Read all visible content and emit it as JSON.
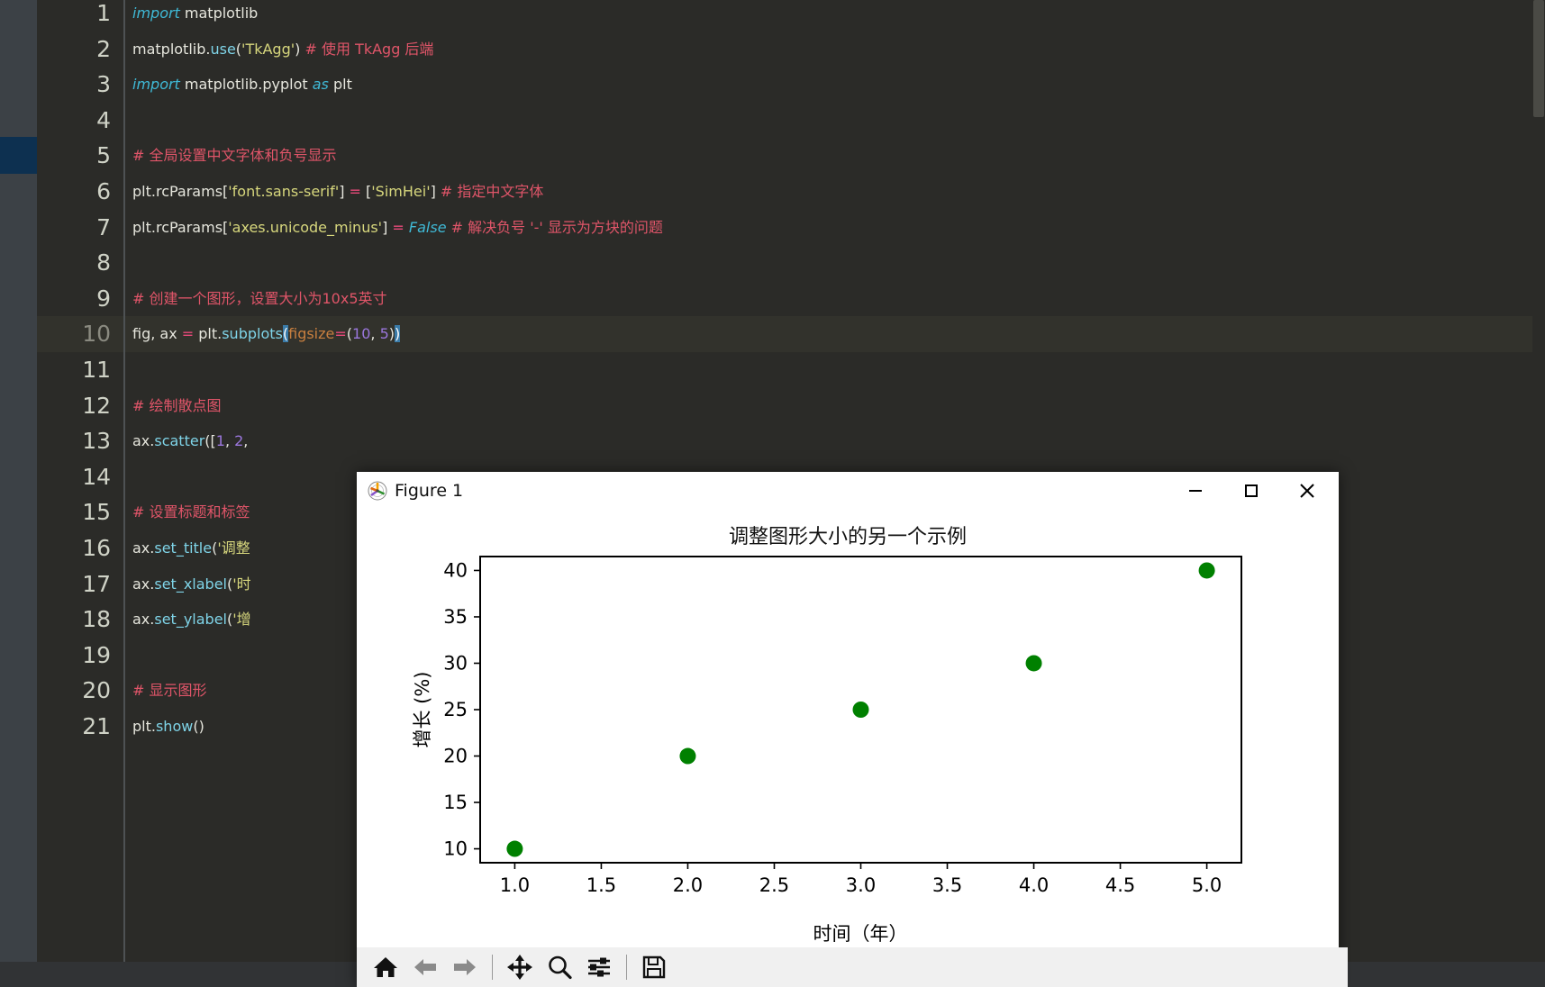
{
  "editor": {
    "lines": [
      {
        "no": "1",
        "tokens": [
          {
            "t": "import",
            "c": "t-kw"
          },
          {
            "t": " matplotlib",
            "c": "t-id"
          }
        ]
      },
      {
        "no": "2",
        "tokens": [
          {
            "t": "matplotlib.",
            "c": "t-id"
          },
          {
            "t": "use",
            "c": "t-fn"
          },
          {
            "t": "(",
            "c": "t-punc"
          },
          {
            "t": "'TkAgg'",
            "c": "t-str"
          },
          {
            "t": ")  ",
            "c": "t-punc"
          },
          {
            "t": "# 使用 TkAgg 后端",
            "c": "t-cmt"
          }
        ]
      },
      {
        "no": "3",
        "tokens": [
          {
            "t": "import",
            "c": "t-kw"
          },
          {
            "t": " matplotlib.pyplot ",
            "c": "t-id"
          },
          {
            "t": "as",
            "c": "t-kw2"
          },
          {
            "t": " plt",
            "c": "t-id"
          }
        ]
      },
      {
        "no": "4",
        "tokens": []
      },
      {
        "no": "5",
        "tokens": [
          {
            "t": "# 全局设置中文字体和负号显示",
            "c": "t-cmt"
          }
        ]
      },
      {
        "no": "6",
        "tokens": [
          {
            "t": "plt.rcParams[",
            "c": "t-id"
          },
          {
            "t": "'font.sans-serif'",
            "c": "t-str"
          },
          {
            "t": "] ",
            "c": "t-punc"
          },
          {
            "t": "=",
            "c": "t-op"
          },
          {
            "t": " [",
            "c": "t-punc"
          },
          {
            "t": "'SimHei'",
            "c": "t-str"
          },
          {
            "t": "]  ",
            "c": "t-punc"
          },
          {
            "t": "# 指定中文字体",
            "c": "t-cmt"
          }
        ]
      },
      {
        "no": "7",
        "tokens": [
          {
            "t": "plt.rcParams[",
            "c": "t-id"
          },
          {
            "t": "'axes.unicode_minus'",
            "c": "t-str"
          },
          {
            "t": "] ",
            "c": "t-punc"
          },
          {
            "t": "=",
            "c": "t-op"
          },
          {
            "t": " ",
            "c": "t-punc"
          },
          {
            "t": "False",
            "c": "t-kw2"
          },
          {
            "t": "    ",
            "c": "t-punc"
          },
          {
            "t": "# 解决负号 '-' 显示为方块的问题",
            "c": "t-cmt"
          }
        ]
      },
      {
        "no": "8",
        "tokens": []
      },
      {
        "no": "9",
        "tokens": [
          {
            "t": "# 创建一个图形，设置大小为10x5英寸",
            "c": "t-cmt"
          }
        ]
      },
      {
        "no": "10",
        "tokens": [
          {
            "t": "fig, ax ",
            "c": "t-id"
          },
          {
            "t": "=",
            "c": "t-op"
          },
          {
            "t": " plt.",
            "c": "t-id"
          },
          {
            "t": "subplots",
            "c": "t-fn"
          },
          {
            "t": "(",
            "c": "sel-paren"
          },
          {
            "t": "figsize",
            "c": "t-kwarg"
          },
          {
            "t": "=",
            "c": "t-op"
          },
          {
            "t": "(",
            "c": "t-punc"
          },
          {
            "t": "10",
            "c": "t-num"
          },
          {
            "t": ", ",
            "c": "t-punc"
          },
          {
            "t": "5",
            "c": "t-num"
          },
          {
            "t": ")",
            "c": "t-punc"
          },
          {
            "t": ")",
            "c": "sel-paren"
          }
        ],
        "current": true
      },
      {
        "no": "11",
        "tokens": []
      },
      {
        "no": "12",
        "tokens": [
          {
            "t": "# 绘制散点图",
            "c": "t-cmt"
          }
        ]
      },
      {
        "no": "13",
        "tokens": [
          {
            "t": "ax.",
            "c": "t-id"
          },
          {
            "t": "scatter",
            "c": "t-fn"
          },
          {
            "t": "([",
            "c": "t-punc"
          },
          {
            "t": "1",
            "c": "t-num"
          },
          {
            "t": ", ",
            "c": "t-punc"
          },
          {
            "t": "2",
            "c": "t-num"
          },
          {
            "t": ",",
            "c": "t-punc"
          }
        ]
      },
      {
        "no": "14",
        "tokens": []
      },
      {
        "no": "15",
        "tokens": [
          {
            "t": "# 设置标题和标签",
            "c": "t-cmt"
          }
        ]
      },
      {
        "no": "16",
        "tokens": [
          {
            "t": "ax.",
            "c": "t-id"
          },
          {
            "t": "set_title",
            "c": "t-fn"
          },
          {
            "t": "(",
            "c": "t-punc"
          },
          {
            "t": "'调整",
            "c": "t-str"
          }
        ]
      },
      {
        "no": "17",
        "tokens": [
          {
            "t": "ax.",
            "c": "t-id"
          },
          {
            "t": "set_xlabel",
            "c": "t-fn"
          },
          {
            "t": "(",
            "c": "t-punc"
          },
          {
            "t": "'时",
            "c": "t-str"
          }
        ]
      },
      {
        "no": "18",
        "tokens": [
          {
            "t": "ax.",
            "c": "t-id"
          },
          {
            "t": "set_ylabel",
            "c": "t-fn"
          },
          {
            "t": "(",
            "c": "t-punc"
          },
          {
            "t": "'增",
            "c": "t-str"
          }
        ]
      },
      {
        "no": "19",
        "tokens": []
      },
      {
        "no": "20",
        "tokens": [
          {
            "t": "# 显示图形",
            "c": "t-cmt"
          }
        ]
      },
      {
        "no": "21",
        "tokens": [
          {
            "t": "plt.",
            "c": "t-id"
          },
          {
            "t": "show",
            "c": "t-fn"
          },
          {
            "t": "()",
            "c": "t-punc"
          }
        ]
      }
    ]
  },
  "figure_window": {
    "title": "Figure 1",
    "icon_name": "matplotlib-logo-icon",
    "controls": {
      "minimize": "—",
      "maximize": "☐",
      "close": "✕"
    },
    "toolbar": {
      "buttons": [
        {
          "name": "home-button",
          "label": "Home"
        },
        {
          "name": "back-button",
          "label": "Back"
        },
        {
          "name": "forward-button",
          "label": "Forward"
        },
        {
          "name": "pan-button",
          "label": "Pan"
        },
        {
          "name": "zoom-button",
          "label": "Zoom"
        },
        {
          "name": "configure-subplots-button",
          "label": "Configure subplots"
        },
        {
          "name": "save-button",
          "label": "Save"
        }
      ]
    }
  },
  "chart_data": {
    "type": "scatter",
    "title": "调整图形大小的另一个示例",
    "xlabel": "时间（年）",
    "ylabel": "增长 (%)",
    "x": [
      1,
      2,
      3,
      4,
      5
    ],
    "y": [
      10,
      20,
      25,
      30,
      40
    ],
    "xlim": [
      0.8,
      5.2
    ],
    "ylim": [
      8.5,
      41.5
    ],
    "xticks": [
      "1.0",
      "1.5",
      "2.0",
      "2.5",
      "3.0",
      "3.5",
      "4.0",
      "4.5",
      "5.0"
    ],
    "xtick_values": [
      1.0,
      1.5,
      2.0,
      2.5,
      3.0,
      3.5,
      4.0,
      4.5,
      5.0
    ],
    "yticks": [
      "10",
      "15",
      "20",
      "25",
      "30",
      "35",
      "40"
    ],
    "ytick_values": [
      10,
      15,
      20,
      25,
      30,
      35,
      40
    ],
    "grid": false,
    "legend": null,
    "marker_color": "#008000",
    "marker_size": 9
  },
  "colors": {
    "editor_bg": "#2b2b28",
    "gutter_bg": "#3c4146",
    "marker_highlight": "#0d3050",
    "current_line_bg": "#32322c",
    "comment": "#e05569",
    "string": "#d7d77d",
    "keyword": "#3fb9d6",
    "function": "#7fd4e8",
    "number": "#9b77dd",
    "operator": "#e84a7a",
    "kwarg": "#c87f3f",
    "selection": "#3a7ba8",
    "plot_marker": "#008000",
    "window_bg": "#ffffff",
    "toolbar_bg": "#f0f0f0"
  }
}
